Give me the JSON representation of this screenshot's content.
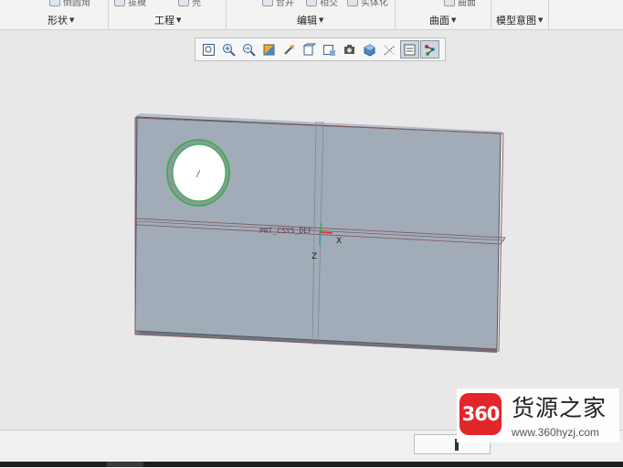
{
  "ribbon": {
    "cut_items": [
      {
        "label": "倒圆角"
      },
      {
        "label": "拔模"
      },
      {
        "label": "壳"
      },
      {
        "label": "合并"
      },
      {
        "label": "相交"
      },
      {
        "label": "实体化"
      },
      {
        "label": "曲面"
      }
    ],
    "groups": [
      {
        "label": "形状"
      },
      {
        "label": "工程"
      },
      {
        "label": "编辑"
      },
      {
        "label": "曲面"
      },
      {
        "label": "模型意图"
      }
    ]
  },
  "view_toolbar": {
    "buttons": [
      {
        "icon": "refit-icon"
      },
      {
        "icon": "zoom-in-icon"
      },
      {
        "icon": "zoom-out-icon"
      },
      {
        "icon": "repaint-icon"
      },
      {
        "icon": "reorient-icon"
      },
      {
        "icon": "saved-views-icon"
      },
      {
        "icon": "view-manager-icon"
      },
      {
        "icon": "perspective-icon"
      },
      {
        "icon": "display-style-icon"
      },
      {
        "icon": "datum-display-icon",
        "active": true
      },
      {
        "icon": "annotation-display-icon",
        "active": true
      },
      {
        "icon": "spin-center-icon",
        "active": true
      }
    ]
  },
  "model": {
    "csys_label": "PRT_CSYS_DEF",
    "x_axis": "X",
    "z_axis": "Z"
  },
  "watermark": {
    "badge": "360",
    "title": "货源之家",
    "url": "www.360hyzj.com"
  },
  "colors": {
    "part_face": "#a2acb9",
    "part_side": "#7b8590",
    "hole_edge": "#3cb043",
    "datum_plane": "#8a5a63"
  }
}
